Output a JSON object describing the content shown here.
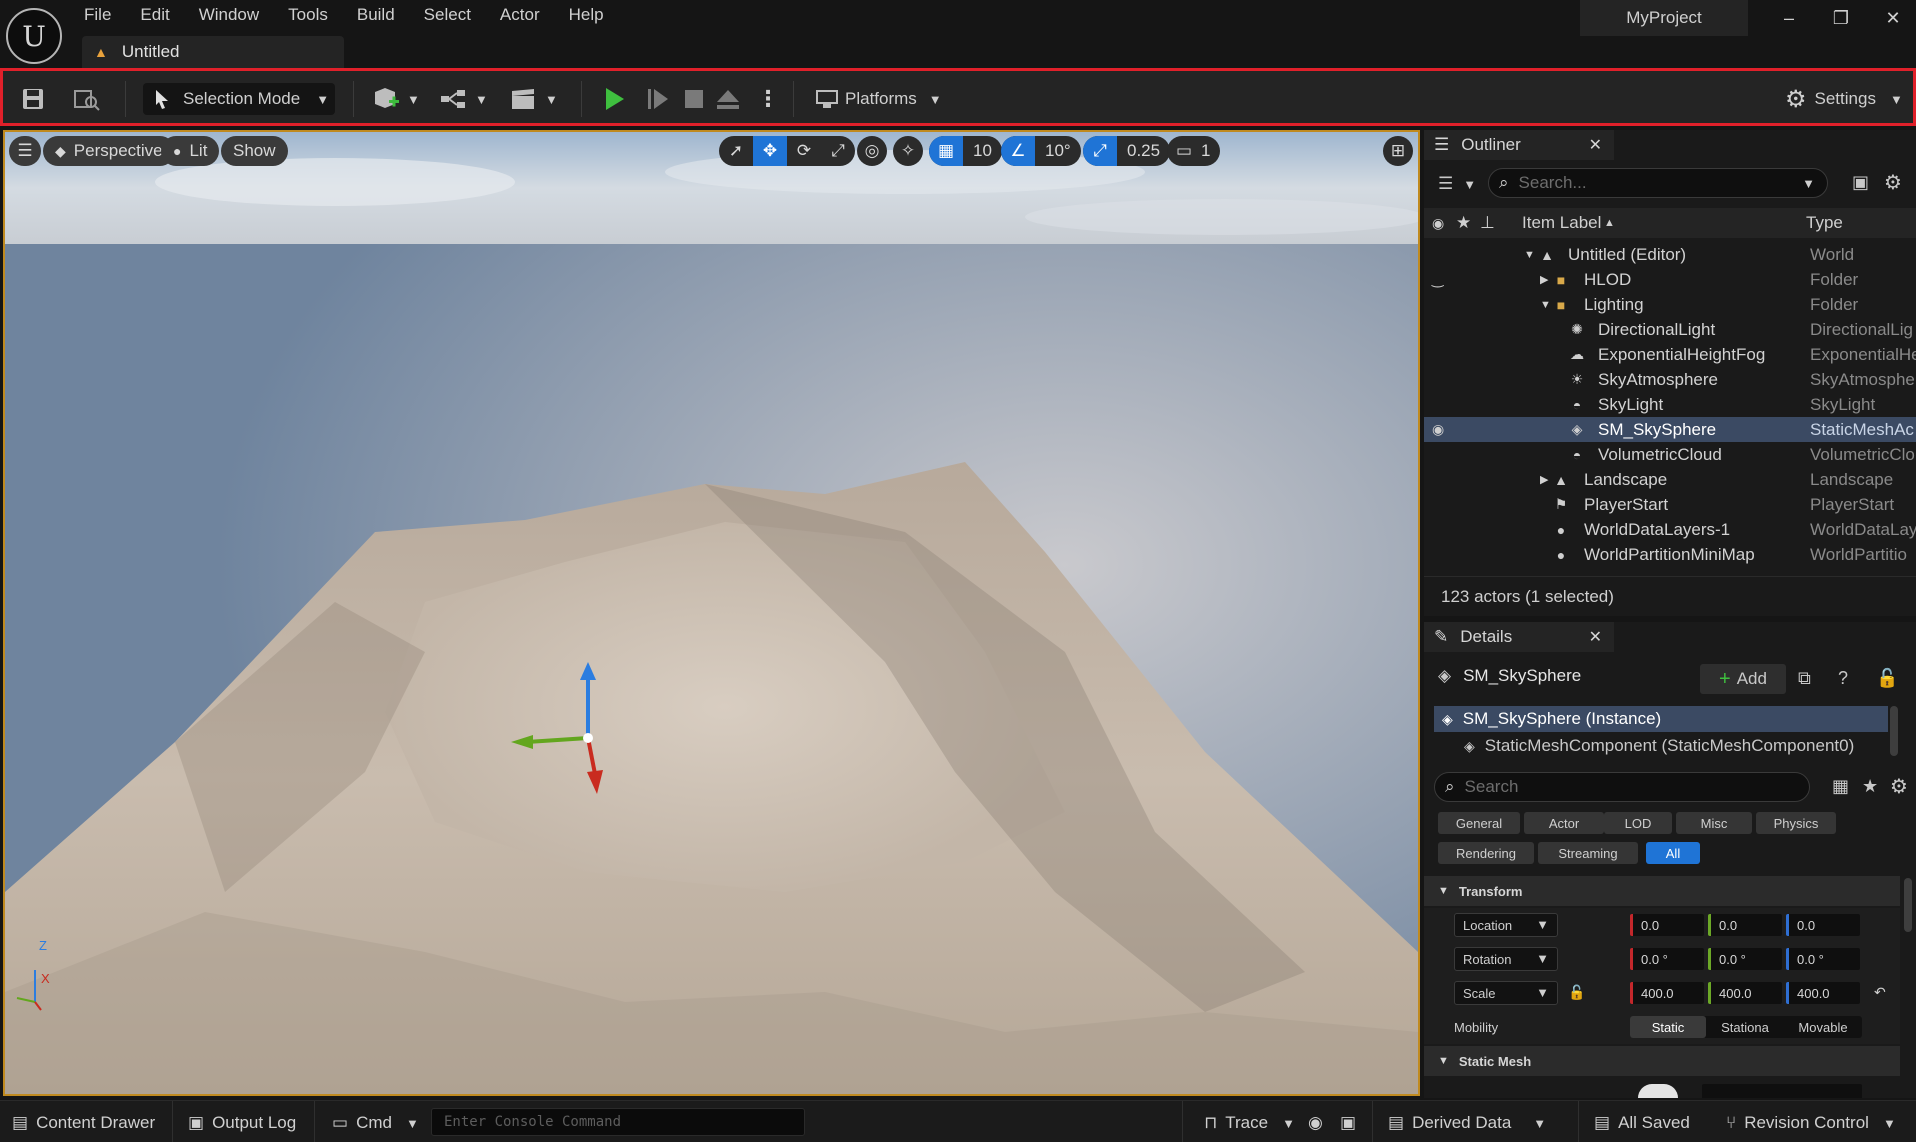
{
  "menu": [
    "File",
    "Edit",
    "Window",
    "Tools",
    "Build",
    "Select",
    "Actor",
    "Help"
  ],
  "document_tab": "Untitled",
  "project_name": "MyProject",
  "window_controls": [
    "–",
    "❐",
    "✕"
  ],
  "toolbar": {
    "selection_mode": "Selection Mode",
    "platforms": "Platforms",
    "settings": "Settings",
    "highlight_color": "#e0202a"
  },
  "viewport": {
    "perspective": "Perspective",
    "lit": "Lit",
    "show": "Show",
    "grid_snap": "10",
    "rotation_snap": "10°",
    "scale_snap": "0.25",
    "camera_speed": "1",
    "axis_z": "Z",
    "axis_x": "X"
  },
  "outliner": {
    "title": "Outliner",
    "search_placeholder": "Search...",
    "col_label": "Item Label",
    "col_type": "Type",
    "rows": [
      {
        "label": "Untitled (Editor)",
        "type": "World",
        "icon": "world-icon"
      },
      {
        "label": "HLOD",
        "type": "Folder",
        "icon": "folder-icon"
      },
      {
        "label": "Lighting",
        "type": "Folder",
        "icon": "folder-open-icon"
      },
      {
        "label": "DirectionalLight",
        "type": "DirectionalLig",
        "icon": "directional-light-icon"
      },
      {
        "label": "ExponentialHeightFog",
        "type": "ExponentialHe",
        "icon": "fog-icon"
      },
      {
        "label": "SkyAtmosphere",
        "type": "SkyAtmosphe",
        "icon": "sky-atmosphere-icon"
      },
      {
        "label": "SkyLight",
        "type": "SkyLight",
        "icon": "skylight-icon"
      },
      {
        "label": "SM_SkySphere",
        "type": "StaticMeshAc",
        "icon": "static-mesh-icon"
      },
      {
        "label": "VolumetricCloud",
        "type": "VolumetricClo",
        "icon": "cloud-icon"
      },
      {
        "label": "Landscape",
        "type": "Landscape",
        "icon": "landscape-icon"
      },
      {
        "label": "PlayerStart",
        "type": "PlayerStart",
        "icon": "player-start-icon"
      },
      {
        "label": "WorldDataLayers-1",
        "type": "WorldDataLay",
        "icon": "world-data-icon"
      },
      {
        "label": "WorldPartitionMiniMap",
        "type": "WorldPartitio",
        "icon": "minimap-icon"
      }
    ],
    "status": "123 actors (1 selected)"
  },
  "details": {
    "title": "Details",
    "actor_name": "SM_SkySphere",
    "add_label": "Add",
    "instance": "SM_SkySphere (Instance)",
    "component": "StaticMeshComponent (StaticMeshComponent0)",
    "search_placeholder": "Search",
    "categories": [
      "General",
      "Actor",
      "LOD",
      "Misc",
      "Physics",
      "Rendering",
      "Streaming",
      "All"
    ],
    "transform_header": "Transform",
    "location_label": "Location",
    "rotation_label": "Rotation",
    "scale_label": "Scale",
    "location": [
      "0.0",
      "0.0",
      "0.0"
    ],
    "rotation": [
      "0.0 °",
      "0.0 °",
      "0.0 °"
    ],
    "scale": [
      "400.0",
      "400.0",
      "400.0"
    ],
    "mobility_label": "Mobility",
    "mobility_options": [
      "Static",
      "Stationa",
      "Movable"
    ],
    "static_mesh_header": "Static Mesh"
  },
  "bottombar": {
    "content_drawer": "Content Drawer",
    "output_log": "Output Log",
    "cmd": "Cmd",
    "console_placeholder": "Enter Console Command",
    "trace": "Trace",
    "derived_data": "Derived Data",
    "all_saved": "All Saved",
    "revision_control": "Revision Control"
  }
}
